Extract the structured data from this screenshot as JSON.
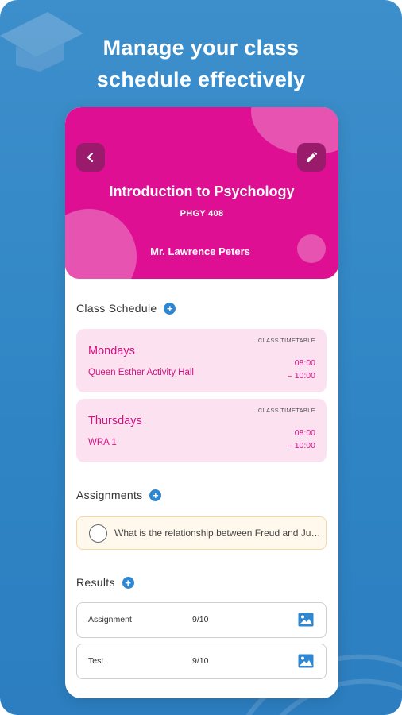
{
  "headline": {
    "line1": "Manage your class",
    "line2": "schedule effectively"
  },
  "header": {
    "course_title": "Introduction to Psychology",
    "course_code": "PHGY 408",
    "teacher": "Mr. Lawrence Peters",
    "accent_color": "#de0f93",
    "back_icon": "chevron-left-icon",
    "edit_icon": "pencil-icon"
  },
  "schedule": {
    "label": "Class Schedule",
    "items": [
      {
        "day": "Mondays",
        "room": "Queen Esther Activity Hall",
        "tag": "CLASS TIMETABLE",
        "start": "08:00",
        "end": "– 10:00"
      },
      {
        "day": "Thursdays",
        "room": "WRA 1",
        "tag": "CLASS TIMETABLE",
        "start": "08:00",
        "end": "– 10:00"
      }
    ]
  },
  "assignments": {
    "label": "Assignments",
    "items": [
      {
        "text": "What is the relationship between Freud and Jung?"
      }
    ]
  },
  "results": {
    "label": "Results",
    "items": [
      {
        "name": "Assignment",
        "score": "9/10",
        "icon": "image-icon"
      },
      {
        "name": "Test",
        "score": "9/10",
        "icon": "image-icon"
      }
    ]
  },
  "colors": {
    "background": "#3d8fcb",
    "plus_button": "#2f87d2",
    "schedule_card": "#fce2f1",
    "assignment_card": "#fff8ec"
  }
}
